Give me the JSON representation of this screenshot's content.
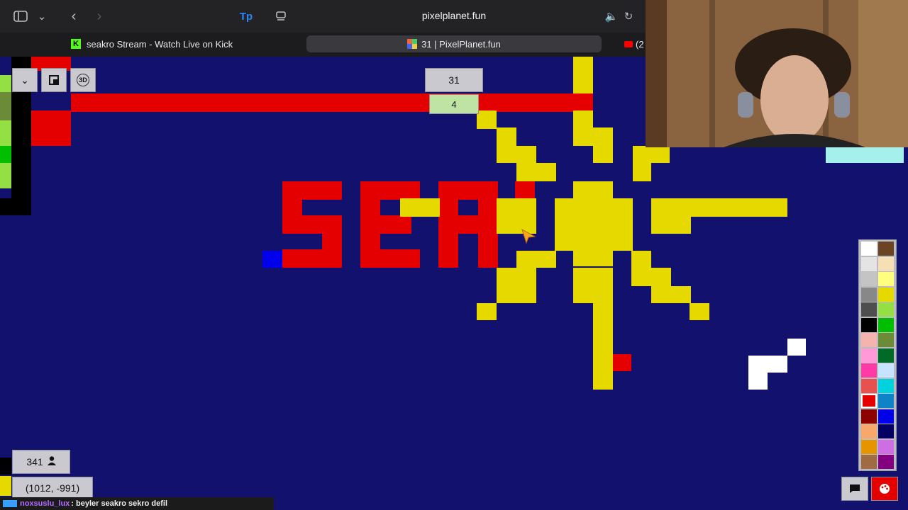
{
  "browser": {
    "address": "pixelplanet.fun",
    "tabs": [
      {
        "label": "seakro Stream - Watch Live on Kick",
        "icon": "kick-icon"
      },
      {
        "label": "31 | PixelPlanet.fun",
        "icon": "pixelplanet-icon",
        "active": true
      },
      {
        "label": "(2",
        "icon": "youtube-icon"
      }
    ]
  },
  "game": {
    "online_users": "341",
    "coordinates": "(1012, -991)",
    "top_counter": "31",
    "sub_counter": "4"
  },
  "chat": {
    "user": "noxsuslu_lux",
    "message": ": beyler seakro sekro defil"
  },
  "palette": {
    "colors": [
      "#ffffff",
      "#6b4423",
      "#e4e4e4",
      "#f6dfb4",
      "#c4c4c4",
      "#fffe7f",
      "#888888",
      "#e5d900",
      "#4e4e4e",
      "#94e044",
      "#000000",
      "#02be01",
      "#f4b3ae",
      "#6b8b39",
      "#ff9ad6",
      "#006a26",
      "#ff39a5",
      "#c6e3ff",
      "#e95050",
      "#00d3dd",
      "#e50000",
      "#0e83c7",
      "#8d0000",
      "#0000ea",
      "#f8a86b",
      "#050064",
      "#e59500",
      "#cf6ee4",
      "#a06a42",
      "#820080"
    ],
    "selected_index": 20
  },
  "colors": {
    "background": "#12126e",
    "red": "#e50000",
    "yellow": "#e5d900",
    "accent": "#e50000"
  }
}
